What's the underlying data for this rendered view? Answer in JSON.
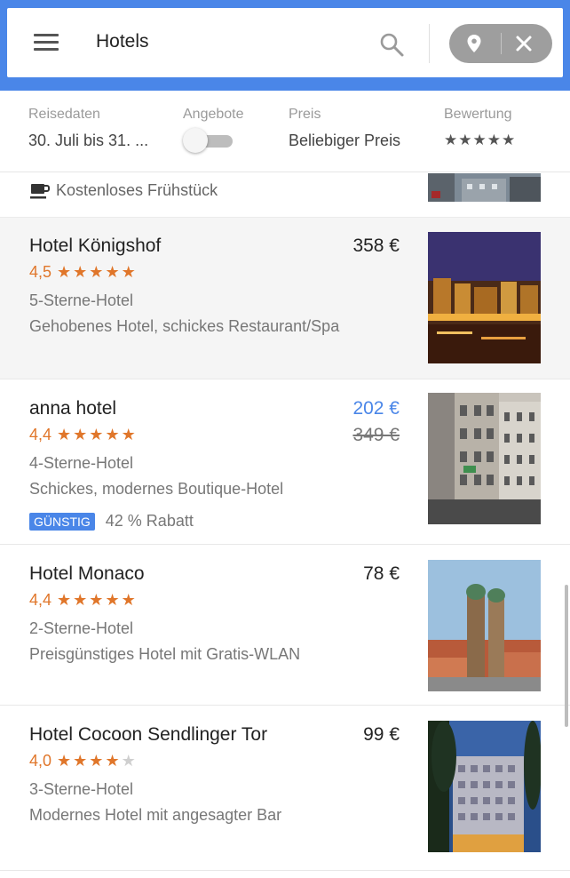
{
  "search": {
    "query": "Hotels",
    "menu_icon": "menu-icon",
    "search_icon": "search-icon",
    "location_icon": "location-pin-icon",
    "clear_icon": "close-icon"
  },
  "filters": [
    {
      "label": "Reisedaten",
      "value": "30. Juli bis 31. ..."
    },
    {
      "label": "Angebote",
      "toggle_on": false
    },
    {
      "label": "Preis",
      "value": "Beliebiger Preis"
    },
    {
      "label": "Bewertung",
      "value": "★★★★★"
    }
  ],
  "partial_item": {
    "amenity_icon": "coffee-cup-icon",
    "text": "Kostenloses Frühstück"
  },
  "hotels": [
    {
      "name": "Hotel Königshof",
      "price": "358 €",
      "rating": "4,5",
      "stars": "★★★★★",
      "hotel_class": "5-Sterne-Hotel",
      "description": "Gehobenes Hotel, schickes Restaurant/Spa"
    },
    {
      "name": "anna hotel",
      "price": "202 €",
      "old_price": "349 €",
      "rating": "4,4",
      "stars": "★★★★★",
      "hotel_class": "4-Sterne-Hotel",
      "description": "Schickes, modernes Boutique-Hotel",
      "badge": "GÜNSTIG",
      "discount": "42 % Rabatt"
    },
    {
      "name": "Hotel Monaco",
      "price": "78 €",
      "rating": "4,4",
      "stars": "★★★★★",
      "hotel_class": "2-Sterne-Hotel",
      "description": "Preisgünstiges Hotel mit Gratis-WLAN"
    },
    {
      "name": "Hotel Cocoon Sendlinger Tor",
      "price": "99 €",
      "rating": "4,0",
      "stars": "★★★★",
      "stars_empty": "★",
      "hotel_class": "3-Sterne-Hotel",
      "description": "Modernes Hotel mit angesagter Bar"
    }
  ],
  "colors": {
    "header_blue": "#4a86e8",
    "rating_orange": "#e0762a",
    "deal_price_blue": "#4a86e8"
  }
}
